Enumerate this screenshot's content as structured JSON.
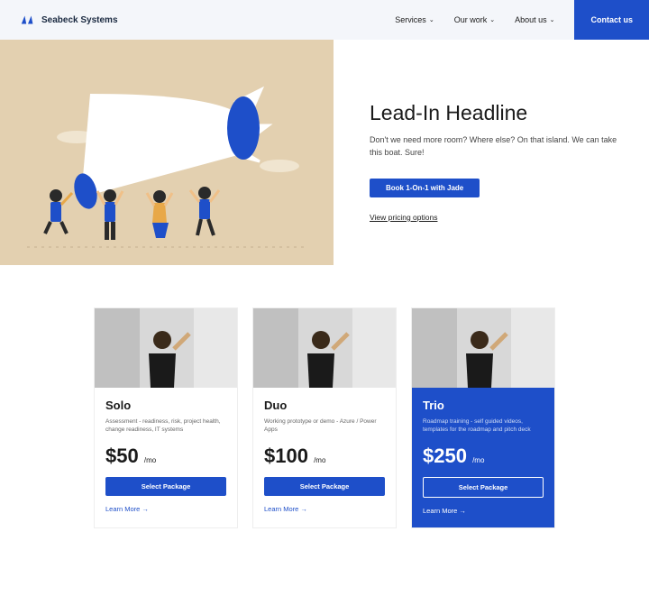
{
  "header": {
    "brand": "Seabeck Systems",
    "nav": [
      {
        "label": "Services"
      },
      {
        "label": "Our work"
      },
      {
        "label": "About us"
      }
    ],
    "contact": "Contact us"
  },
  "hero": {
    "title": "Lead-In Headline",
    "subtitle": "Don't we need more room? Where else? On that island.  We can take this boat. Sure!",
    "cta": "Book 1-On-1 with Jade",
    "link": "View pricing options"
  },
  "pricing": [
    {
      "name": "Solo",
      "desc": "Assessment - readiness, risk, project health, change readiness, IT systems",
      "price": "$50",
      "per": "/mo",
      "btn": "Select Package",
      "link": "Learn More →",
      "featured": false
    },
    {
      "name": "Duo",
      "desc": "Working prototype or demo - Azure / Power Apps",
      "price": "$100",
      "per": "/mo",
      "btn": "Select Package",
      "link": "Learn More →",
      "featured": false
    },
    {
      "name": "Trio",
      "desc": "Roadmap training - self guided videos, templates for the roadmap and pitch deck",
      "price": "$250",
      "per": "/mo",
      "btn": "Select Package",
      "link": "Learn More →",
      "featured": true
    }
  ]
}
